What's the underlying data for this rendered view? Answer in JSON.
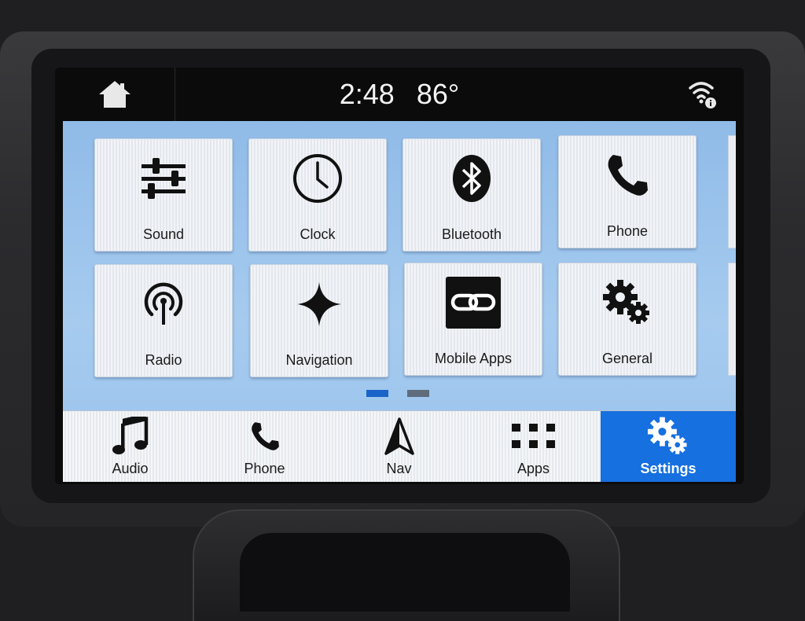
{
  "status": {
    "time": "2:48",
    "temperature": "86°"
  },
  "tiles": [
    {
      "label": "Sound",
      "icon": "sliders-icon"
    },
    {
      "label": "Clock",
      "icon": "clock-icon"
    },
    {
      "label": "Bluetooth",
      "icon": "bluetooth-icon"
    },
    {
      "label": "Phone",
      "icon": "phone-icon"
    },
    {
      "label": "Radio",
      "icon": "radio-icon"
    },
    {
      "label": "Navigation",
      "icon": "compass-star-icon"
    },
    {
      "label": "Mobile Apps",
      "icon": "link-icon"
    },
    {
      "label": "General",
      "icon": "gears-icon"
    }
  ],
  "pager": {
    "total": 2,
    "active": 1,
    "active_color": "#1a63c9",
    "inactive_color": "#5f6c7b"
  },
  "nav": [
    {
      "label": "Audio",
      "icon": "music-note-icon"
    },
    {
      "label": "Phone",
      "icon": "phone-icon"
    },
    {
      "label": "Nav",
      "icon": "navigation-arrow-icon"
    },
    {
      "label": "Apps",
      "icon": "grid-icon"
    },
    {
      "label": "Settings",
      "icon": "gears-icon",
      "active": true
    }
  ],
  "colors": {
    "accent": "#1670e0",
    "apps_background": "#9fc6ee"
  }
}
